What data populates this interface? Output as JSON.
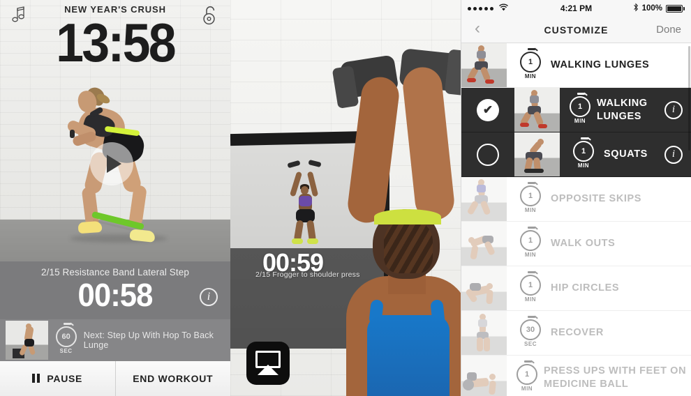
{
  "panel1": {
    "name": "workout-player",
    "header": {
      "title": "NEW YEAR'S CRUSH",
      "music_icon": "music-note-icon",
      "lock_icon": "unlocked-padlock-icon"
    },
    "total_time": "13:58",
    "play_button": "play-icon",
    "exercise_label": "2/15 Resistance Band Lateral Step",
    "exercise_timer": "00:58",
    "info_icon": "i",
    "next": {
      "duration_value": "60",
      "duration_unit": "SEC",
      "text": "Next: Step Up With Hop To Back Lunge"
    },
    "buttons": {
      "pause": "PAUSE",
      "end": "END WORKOUT"
    }
  },
  "panel2": {
    "name": "workout-video",
    "timer": "00:59",
    "subtitle": "2/15  Frogger to shoulder press",
    "airplay_icon": "airplay-icon"
  },
  "panel3": {
    "name": "customize-screen",
    "statusbar": {
      "signal_dots": 5,
      "wifi": "wifi-icon",
      "time": "4:21 PM",
      "bluetooth": "bluetooth-icon",
      "battery_pct": "100%"
    },
    "navbar": {
      "back": "back-chevron-icon",
      "title": "CUSTOMIZE",
      "done": "Done"
    },
    "rows": [
      {
        "label": "WALKING LUNGES",
        "value": "1",
        "unit": "MIN",
        "state": "active",
        "selector": "none",
        "info": false
      },
      {
        "label": "WALKING LUNGES",
        "value": "1",
        "unit": "MIN",
        "state": "dark",
        "selector": "checked",
        "info": true
      },
      {
        "label": "SQUATS",
        "value": "1",
        "unit": "MIN",
        "state": "dark",
        "selector": "unchecked",
        "info": true
      },
      {
        "label": "OPPOSITE SKIPS",
        "value": "1",
        "unit": "MIN",
        "state": "faded",
        "selector": "none",
        "info": false
      },
      {
        "label": "WALK OUTS",
        "value": "1",
        "unit": "MIN",
        "state": "faded",
        "selector": "none",
        "info": false
      },
      {
        "label": "HIP CIRCLES",
        "value": "1",
        "unit": "MIN",
        "state": "faded",
        "selector": "none",
        "info": false
      },
      {
        "label": "RECOVER",
        "value": "30",
        "unit": "SEC",
        "state": "faded",
        "selector": "none",
        "info": false
      },
      {
        "label": "PRESS UPS WITH FEET ON MEDICINE BALL",
        "value": "1",
        "unit": "MIN",
        "state": "faded",
        "selector": "none",
        "info": false
      }
    ]
  },
  "colors": {
    "dark_row": "#2e2e2e",
    "info_panel": "#7b7b7d",
    "band_green": "#6ec82a",
    "tank_blue": "#1878c9"
  }
}
